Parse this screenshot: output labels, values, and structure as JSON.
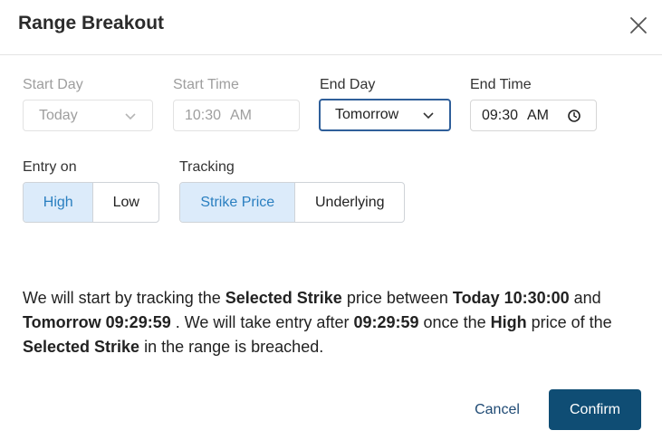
{
  "dialog": {
    "title": "Range Breakout"
  },
  "fields": {
    "start_day": {
      "label": "Start Day",
      "value": "Today",
      "disabled": true
    },
    "start_time": {
      "label": "Start Time",
      "value": "10:30",
      "ampm": "AM",
      "disabled": true
    },
    "end_day": {
      "label": "End Day",
      "value": "Tomorrow"
    },
    "end_time": {
      "label": "End Time",
      "value": "09:30",
      "ampm": "AM"
    }
  },
  "entry_on": {
    "label": "Entry on",
    "options": [
      "High",
      "Low"
    ],
    "selected": "High"
  },
  "tracking": {
    "label": "Tracking",
    "options": [
      "Strike Price",
      "Underlying"
    ],
    "selected": "Strike Price"
  },
  "description": {
    "p1": "We will start by tracking the ",
    "b1": "Selected Strike",
    "p2": " price between ",
    "b2": "Today 10:30:00",
    "p3": " and ",
    "b3": "Tomorrow 09:29:59",
    "p4": " . We will take entry after ",
    "b4": "09:29:59",
    "p5": " once the ",
    "b5": "High",
    "p6": " price of the ",
    "b6": "Selected Strike",
    "p7": " in the range is breached."
  },
  "actions": {
    "cancel": "Cancel",
    "confirm": "Confirm"
  },
  "colors": {
    "primary": "#0f4d74",
    "active_segment_bg": "#dcebfa",
    "active_segment_text": "#2a7fc0",
    "focus_border": "#2f5f9a"
  }
}
